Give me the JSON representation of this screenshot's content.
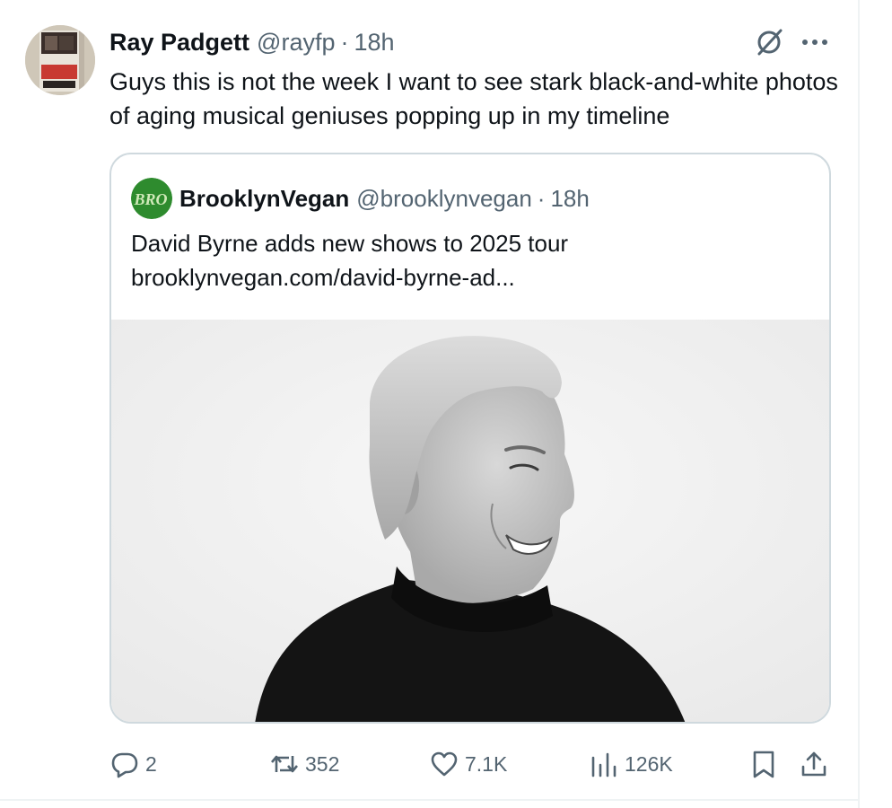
{
  "tweet": {
    "author_name": "Ray Padgett",
    "author_handle": "@rayfp",
    "separator": "·",
    "time": "18h",
    "text": "Guys this is not the week I want to see stark black-and-white photos of aging musical geniuses popping up in my timeline"
  },
  "quoted_tweet": {
    "author_name": "BrooklynVegan",
    "author_handle": "@brooklynvegan",
    "separator": "·",
    "time": "18h",
    "text_line1": "David Byrne adds new shows to 2025 tour",
    "link": "brooklynvegan.com/david-byrne-ad...",
    "avatar_logo_text": "BRO"
  },
  "actions": {
    "replies": "2",
    "reposts": "352",
    "likes": "7.1K",
    "views": "126K"
  },
  "icons": {
    "reply": "speech-bubble-icon",
    "repost": "repost-arrows-icon",
    "like": "heart-icon",
    "views": "bar-chart-icon",
    "bookmark": "bookmark-icon",
    "share": "share-upload-icon",
    "grok": "grok-slash-icon",
    "more": "ellipsis-icon"
  },
  "colors": {
    "text_primary": "#0f1419",
    "text_secondary": "#536471",
    "border": "#cfd9de",
    "brooklynvegan_green": "#2e8b2e"
  }
}
